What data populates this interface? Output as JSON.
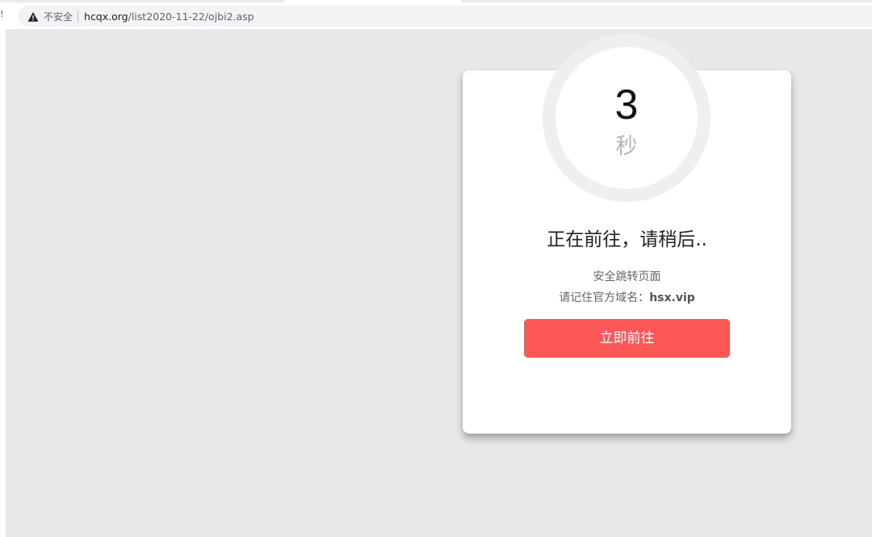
{
  "browser": {
    "security_label": "不安全",
    "url_host": "hcqx.org",
    "url_path": "/list2020-11-22/ojbi2.asp",
    "edge_glyph": "!"
  },
  "redirect": {
    "countdown": "3",
    "unit": "秒",
    "headline": "正在前往，请稍后..",
    "notice": "安全跳转页面",
    "domain_prefix": "请记住官方域名：",
    "domain": "hsx.vip",
    "button_label": "立即前往"
  },
  "colors": {
    "page_background": "#e6e8e9",
    "button": "#fe5758",
    "ring": "#f1efee"
  }
}
